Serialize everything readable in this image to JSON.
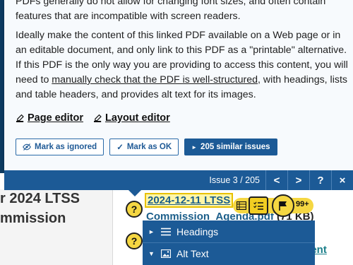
{
  "background": {
    "heading_line1": "r 2024 LTSS",
    "heading_line2": "mmission",
    "link_text": "2024-12-11 LTSS",
    "link_sub": "Commission_Agenda.pdf",
    "file_size": "(71 KB)",
    "link2": "ment"
  },
  "panel": {
    "paragraph1": "PDFs generally do not allow for changing font sizes, and often contain features that are incompatible with screen readers.",
    "p2_before": "Ideally make the content of this linked PDF available on a Web page or in an editable document, and only link to this PDF as a \"printable\" alternative. If this PDF is the only way you are providing to access this content, you will need to ",
    "p2_link": "manually check that the PDF is well-structured",
    "p2_after": ", with headings, lists and table headers, and provides alt text for its images.",
    "page_editor": "Page editor",
    "layout_editor": "Layout editor",
    "mark_ignored": "Mark as ignored",
    "mark_ok": "Mark as OK",
    "similar_issues": "205 similar issues"
  },
  "navbar": {
    "issue_count": "Issue 3 / 205",
    "prev": "<",
    "next": ">",
    "help": "?",
    "close": "×"
  },
  "badges": {
    "help_symbol": "?"
  },
  "toolbar": {
    "count": "99+"
  },
  "outline_menu": {
    "items": [
      {
        "label": "Headings",
        "expanded": false
      },
      {
        "label": "Alt Text",
        "expanded": true
      }
    ]
  },
  "colors": {
    "brand": "#1c5a96",
    "badge": "#f5d742"
  }
}
